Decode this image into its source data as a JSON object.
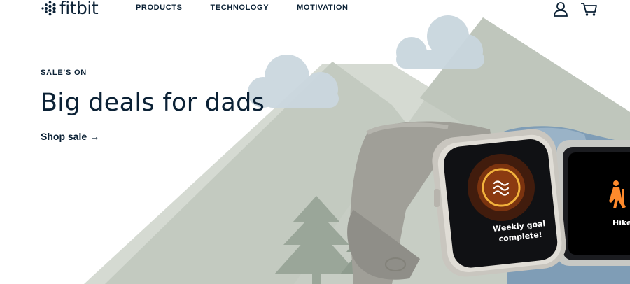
{
  "brand": {
    "name": "fitbit"
  },
  "nav": {
    "items": [
      {
        "label": "PRODUCTS"
      },
      {
        "label": "TECHNOLOGY"
      },
      {
        "label": "MOTIVATION"
      }
    ]
  },
  "header_icons": {
    "account": "user-icon",
    "cart": "cart-icon"
  },
  "hero": {
    "eyebrow": "SALE'S ON",
    "headline": "Big deals for dads",
    "cta_label": "Shop sale",
    "cta_arrow": "→"
  },
  "watch_front": {
    "line1": "Weekly goal",
    "line2": "complete!"
  },
  "watch_back": {
    "label": "Hike"
  },
  "colors": {
    "text": "#0b2135",
    "mountain": "#c4cbc2",
    "cloud": "#c9d6de",
    "tree": "#93a092",
    "band_grey": "#9d9e98",
    "band_blue": "#7d9bb4"
  }
}
